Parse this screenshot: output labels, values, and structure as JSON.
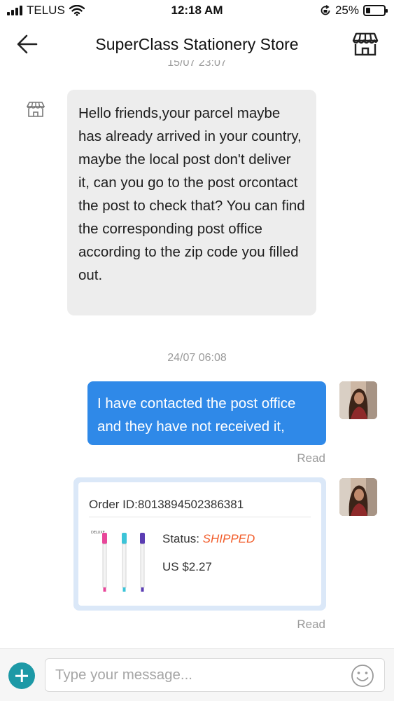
{
  "status_bar": {
    "carrier": "TELUS",
    "time": "12:18 AM",
    "battery": "25%",
    "battery_level": 0.25,
    "icons": [
      "signal-icon",
      "wifi-icon",
      "rotation-lock-icon",
      "battery-icon"
    ]
  },
  "header": {
    "title": "SuperClass Stationery Store",
    "back_icon": "back-arrow-icon",
    "store_icon": "store-icon"
  },
  "messages": {
    "clipped_timestamp": "15/07 23:07",
    "incoming_text": "Hello friends,your parcel maybe has already arrived in your country, maybe the local post don't deliver it, can you go to the post orcontact the post to check that?  You can find the corresponding post office according to the zip code you filled out.",
    "timestamp": "24/07 06:08",
    "outgoing_text": "I have contacted the post office and they have not received it,",
    "read_label_1": "Read",
    "read_label_2": "Read"
  },
  "order_card": {
    "order_id": "Order ID:8013894502386381",
    "status_label": "Status: ",
    "status_value": "SHIPPED",
    "price": "US $2.27",
    "product_label": "DELUXE"
  },
  "composer": {
    "placeholder": "Type your message...",
    "value": ""
  },
  "colors": {
    "outgoing_bubble": "#2f89e8",
    "incoming_bubble": "#ededed",
    "status_shipped": "#f25c2a",
    "add_button": "#1d99a6"
  }
}
